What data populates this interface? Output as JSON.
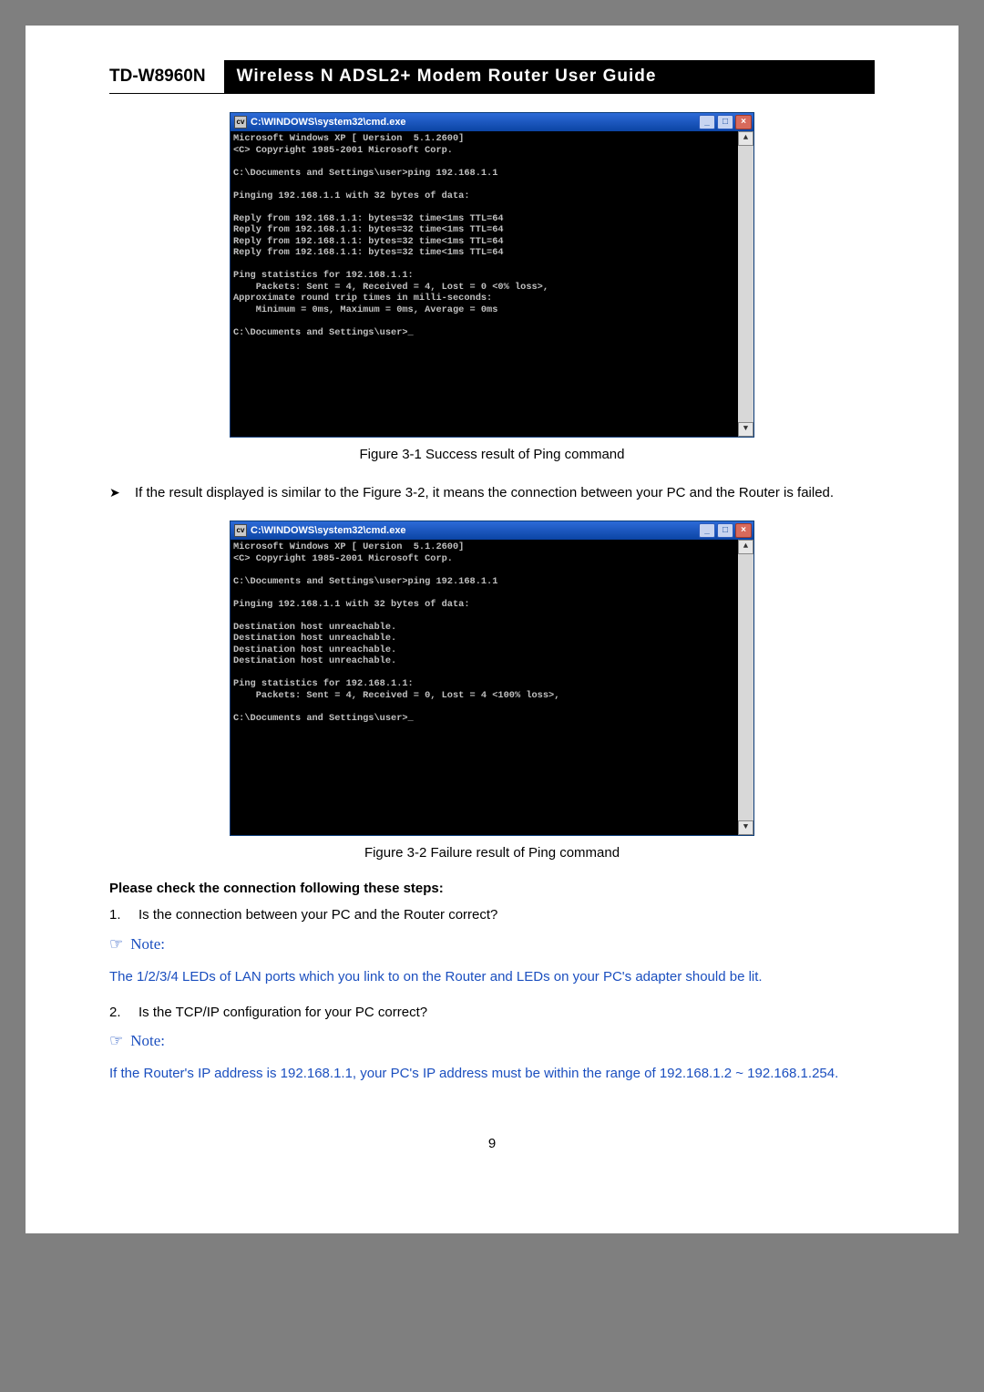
{
  "header": {
    "model": "TD-W8960N",
    "title": "Wireless N ADSL2+ Modem Router User Guide"
  },
  "cmd1": {
    "title": "C:\\WINDOWS\\system32\\cmd.exe",
    "icon_label": "cv",
    "lines": "Microsoft Windows XP [ Uersion  5.1.2600]\n<C> Copyright 1985-2001 Microsoft Corp.\n\nC:\\Documents and Settings\\user>ping 192.168.1.1\n\nPinging 192.168.1.1 with 32 bytes of data:\n\nReply from 192.168.1.1: bytes=32 time<1ms TTL=64\nReply from 192.168.1.1: bytes=32 time<1ms TTL=64\nReply from 192.168.1.1: bytes=32 time<1ms TTL=64\nReply from 192.168.1.1: bytes=32 time<1ms TTL=64\n\nPing statistics for 192.168.1.1:\n    Packets: Sent = 4, Received = 4, Lost = 0 <0% loss>,\nApproximate round trip times in milli-seconds:\n    Minimum = 0ms, Maximum = 0ms, Average = 0ms\n\nC:\\Documents and Settings\\user>_"
  },
  "fig1_caption": "Figure 3-1    Success result of Ping command",
  "bullet1": "If the result displayed is similar to the Figure 3-2, it means the connection between your PC and the Router is failed.",
  "cmd2": {
    "title": "C:\\WINDOWS\\system32\\cmd.exe",
    "icon_label": "cv",
    "lines": "Microsoft Windows XP [ Uersion  5.1.2600]\n<C> Copyright 1985-2001 Microsoft Corp.\n\nC:\\Documents and Settings\\user>ping 192.168.1.1\n\nPinging 192.168.1.1 with 32 bytes of data:\n\nDestination host unreachable.\nDestination host unreachable.\nDestination host unreachable.\nDestination host unreachable.\n\nPing statistics for 192.168.1.1:\n    Packets: Sent = 4, Received = 0, Lost = 4 <100% loss>,\n\nC:\\Documents and Settings\\user>_"
  },
  "fig2_caption": "Figure 3-2    Failure result of Ping command",
  "check_heading": "Please check the connection following these steps:",
  "step1": {
    "num": "1.",
    "text": "Is the connection between your PC and the Router correct?"
  },
  "note_label": "Note:",
  "note1_body": "The 1/2/3/4 LEDs of LAN ports which you link to on the Router and LEDs on your PC's adapter should be lit.",
  "step2": {
    "num": "2.",
    "text": "Is the TCP/IP configuration for your PC correct?"
  },
  "note2_body": "If the Router's IP address is 192.168.1.1, your PC's IP address must be within the range of 192.168.1.2 ~ 192.168.1.254.",
  "page_number": "9",
  "win_buttons": {
    "min": "_",
    "max": "□",
    "close": "×"
  },
  "scroll": {
    "up": "▲",
    "down": "▼"
  }
}
